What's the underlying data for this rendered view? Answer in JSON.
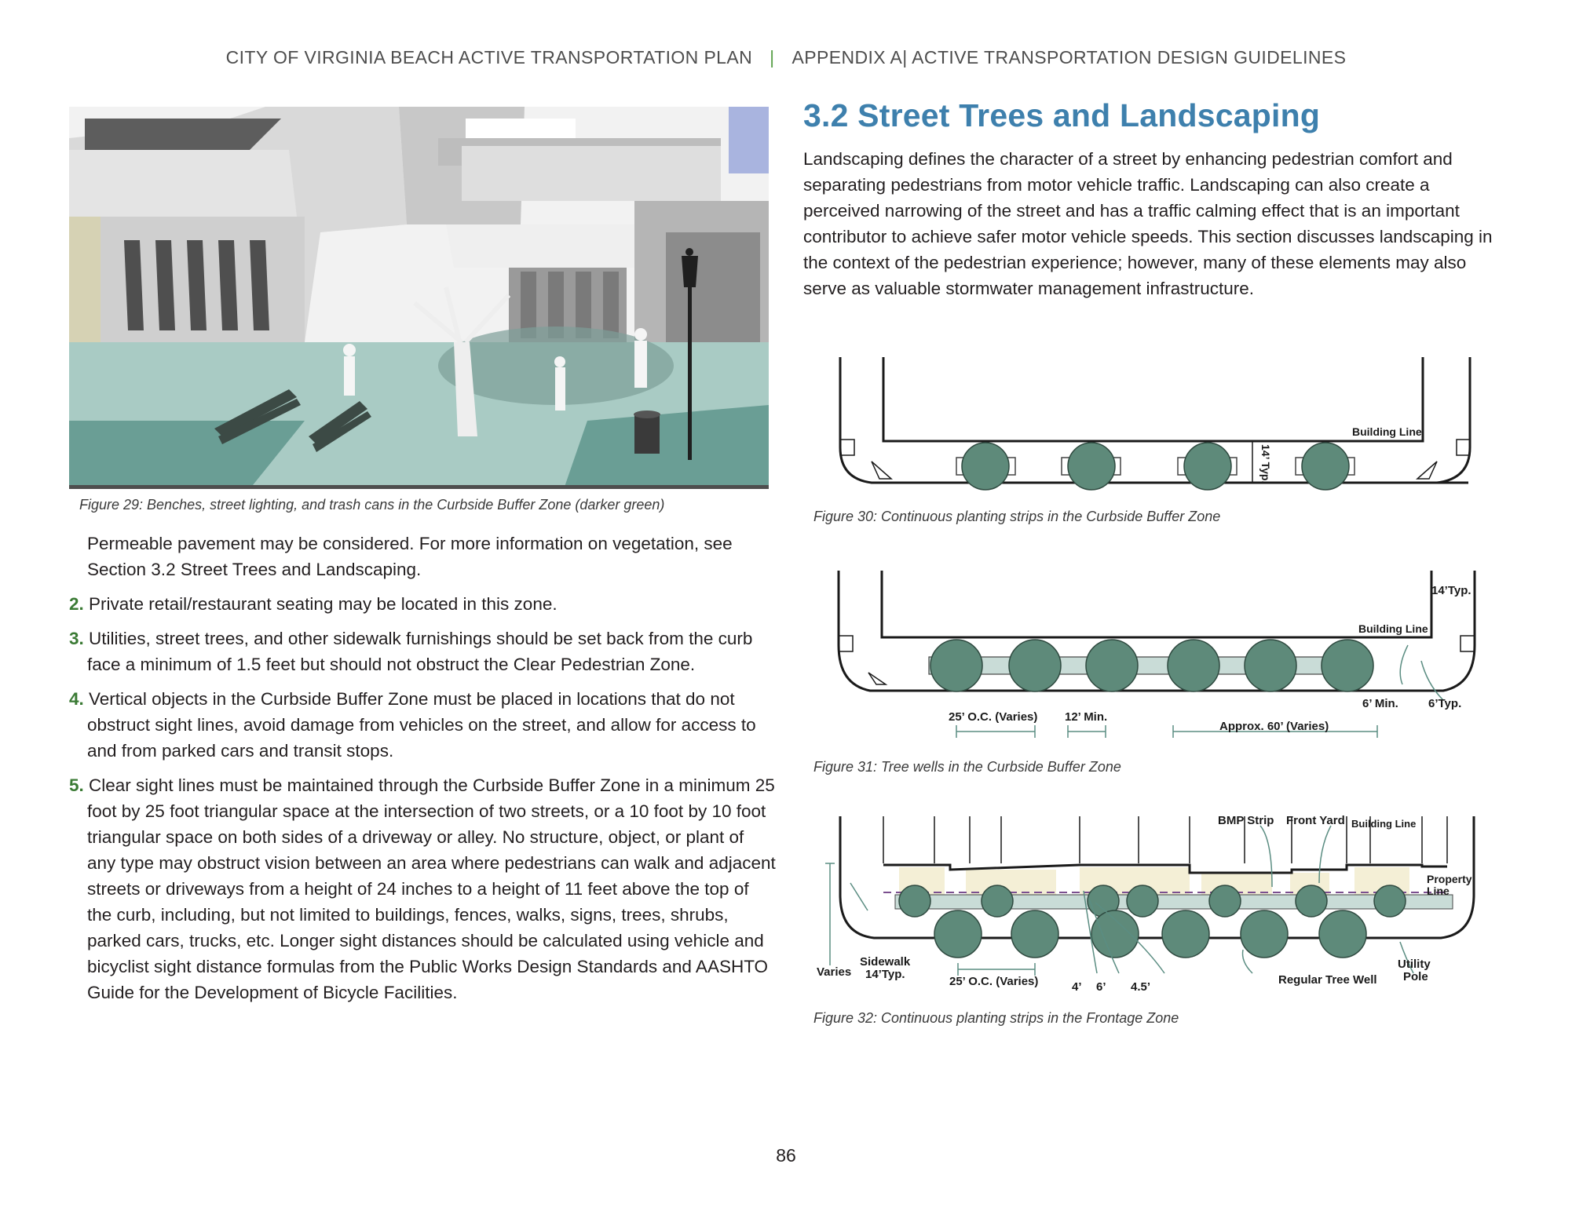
{
  "header": {
    "left": "CITY OF VIRGINIA BEACH ACTIVE TRANSPORTATION PLAN",
    "separator": "|",
    "right": "APPENDIX A| ACTIVE TRANSPORTATION  DESIGN GUIDELINES"
  },
  "left_column": {
    "figure_caption": "Figure 29: Benches, street lighting, and trash cans in the Curbside Buffer Zone (darker green)",
    "continuation": "Permeable pavement may be considered. For more information on vegetation, see Section 3.2 Street Trees and Landscaping.",
    "items": [
      {
        "number": "2.",
        "text": "Private retail/restaurant seating may be located in this zone."
      },
      {
        "number": "3.",
        "text": "Utilities, street trees, and other sidewalk furnishings should be set back from the curb face a minimum of 1.5 feet but should not obstruct the Clear Pedestrian Zone."
      },
      {
        "number": "4.",
        "text": "Vertical objects in the Curbside Buffer Zone must be placed in locations that do not obstruct sight lines, avoid damage from vehicles on the street, and allow for access to and from parked cars and transit stops."
      },
      {
        "number": "5.",
        "text": "Clear sight lines must be maintained through the Curbside Buffer Zone in a minimum 25 foot by 25 foot triangular space at the intersection of two streets, or a 10 foot by 10 foot triangular space on both sides of a driveway or alley. No structure, object, or plant of any type may obstruct vision between an area where pedestrians can walk and adjacent streets or driveways from a height of 24 inches to a height of 11 feet above the top of the curb, including, but not limited to buildings, fences, walks, signs, trees, shrubs, parked cars, trucks, etc. Longer sight distances should be calculated using vehicle and bicyclist sight distance formulas from the Public Works Design Standards and AASHTO Guide for the Development of Bicycle Facilities."
      }
    ]
  },
  "section": {
    "title": "3.2 Street Trees and Landscaping",
    "body": "Landscaping defines the character of a street by enhancing pedestrian comfort and separating pedestrians from motor vehicle traffic. Landscaping can also create a perceived narrowing of the street and has a traffic calming effect that is an important contributor to achieve safer motor vehicle speeds. This section discusses landscaping in the context of the pedestrian experience; however, many of these elements may also serve as valuable stormwater management infrastructure."
  },
  "figure30": {
    "caption": "Figure 30: Continuous planting strips in the Curbside Buffer Zone",
    "label_building_line": "Building Line",
    "label_dim": "14’ Typ."
  },
  "figure31": {
    "caption": "Figure 31: Tree wells in the Curbside Buffer Zone",
    "label_building_line": "Building Line",
    "label_14typ": "14’Typ.",
    "label_spacing": "25’ O.C. (Varies)",
    "label_min": "12’ Min.",
    "label_approx": "Approx. 60’ (Varies)",
    "label_6min": "6’ Min.",
    "label_6typ": "6’Typ."
  },
  "figure32": {
    "caption": "Figure 32: Continuous planting strips in the Frontage Zone",
    "label_bmp": "BMP Strip",
    "label_front_yard": "Front Yard",
    "label_building_line": "Building Line",
    "label_property_1": "Property",
    "label_property_2": "Line",
    "label_varies": "Varies",
    "label_sidewalk_1": "Sidewalk",
    "label_sidewalk_2": "14’Typ.",
    "label_spacing": "25’ O.C. (Varies)",
    "label_4": "4’",
    "label_6": "6’",
    "label_45": "4.5’",
    "label_tree_well": "Regular Tree Well",
    "label_utility_1": "Utility",
    "label_utility_2": "Pole"
  },
  "page_number": "86",
  "colors": {
    "title_blue": "#3e80ad",
    "list_number_green": "#3a7a34",
    "tree_green": "#5e8a7a",
    "buffer_dark": "#6a9e95",
    "sidewalk_light": "#a9cbc4"
  }
}
